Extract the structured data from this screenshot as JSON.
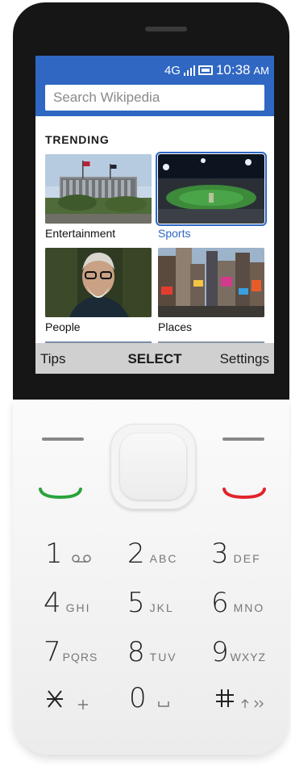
{
  "status_bar": {
    "network": "4G",
    "time": "10:38",
    "ampm": "AM",
    "colors": {
      "bar": "#2f67c3"
    }
  },
  "search": {
    "placeholder": "Search Wikipedia"
  },
  "section": {
    "title": "TRENDING"
  },
  "tiles": [
    {
      "label": "Entertainment",
      "selected": false
    },
    {
      "label": "Sports",
      "selected": true
    },
    {
      "label": "People",
      "selected": false
    },
    {
      "label": "Places",
      "selected": false
    }
  ],
  "softkeys": {
    "left": "Tips",
    "center": "SELECT",
    "right": "Settings"
  },
  "keypad": [
    {
      "num": "1",
      "letters": ""
    },
    {
      "num": "2",
      "letters": "ABC"
    },
    {
      "num": "3",
      "letters": "DEF"
    },
    {
      "num": "4",
      "letters": "GHI"
    },
    {
      "num": "5",
      "letters": "JKL"
    },
    {
      "num": "6",
      "letters": "MNO"
    },
    {
      "num": "7",
      "letters": "PQRS"
    },
    {
      "num": "8",
      "letters": "TUV"
    },
    {
      "num": "9",
      "letters": "WXYZ"
    },
    {
      "num": "0",
      "letters": ""
    }
  ],
  "icons": {
    "voicemail": "voicemail-icon",
    "space": "space-icon",
    "star": "star-key",
    "hash": "hash-key",
    "call": "call-icon",
    "end_call": "end-call-icon"
  }
}
